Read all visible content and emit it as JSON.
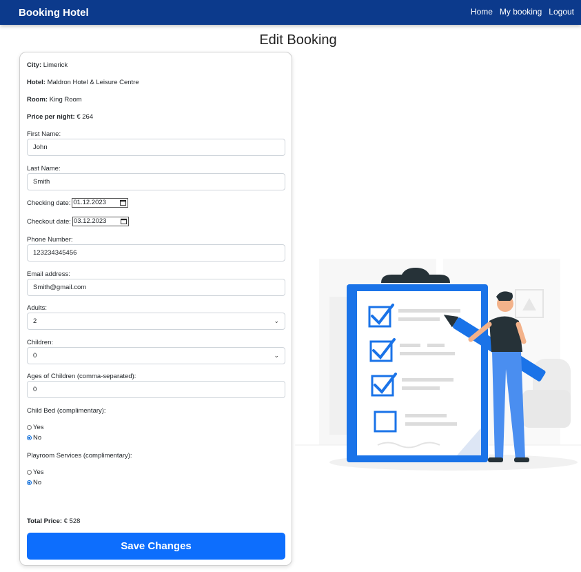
{
  "navbar": {
    "brand": "Booking Hotel",
    "links": [
      "Home",
      "My booking",
      "Logout"
    ]
  },
  "page_title": "Edit Booking",
  "booking": {
    "city_label": "City:",
    "city": "Limerick",
    "hotel_label": "Hotel:",
    "hotel": "Maldron Hotel & Leisure Centre",
    "room_label": "Room:",
    "room": "King Room",
    "price_label": "Price per night:",
    "price": "€ 264"
  },
  "form": {
    "first_name_label": "First Name:",
    "first_name": "John",
    "last_name_label": "Last Name:",
    "last_name": "Smith",
    "checkin_label": "Checking date:",
    "checkin": "01.12.2023",
    "checkout_label": "Checkout date:",
    "checkout": "03.12.2023",
    "phone_label": "Phone Number:",
    "phone": "123234345456",
    "email_label": "Email address:",
    "email": "Smith@gmail.com",
    "adults_label": "Adults:",
    "adults": "2",
    "children_label": "Children:",
    "children": "0",
    "ages_label": "Ages of Children (comma-separated):",
    "ages": "0",
    "childbed_label": "Child Bed (complimentary):",
    "playroom_label": "Playroom Services (complimentary):",
    "yes": "Yes",
    "no": "No",
    "childbed_selected": "No",
    "playroom_selected": "No"
  },
  "total_label": "Total Price:",
  "total": "€ 528",
  "save_label": "Save Changes",
  "colors": {
    "navbar": "#0c3a8c",
    "primary_button": "#0d6efd",
    "illustration_accent": "#1a73e8"
  },
  "icons": [
    "calendar-icon",
    "chevron-down-icon",
    "clipboard-checklist-illustration"
  ]
}
